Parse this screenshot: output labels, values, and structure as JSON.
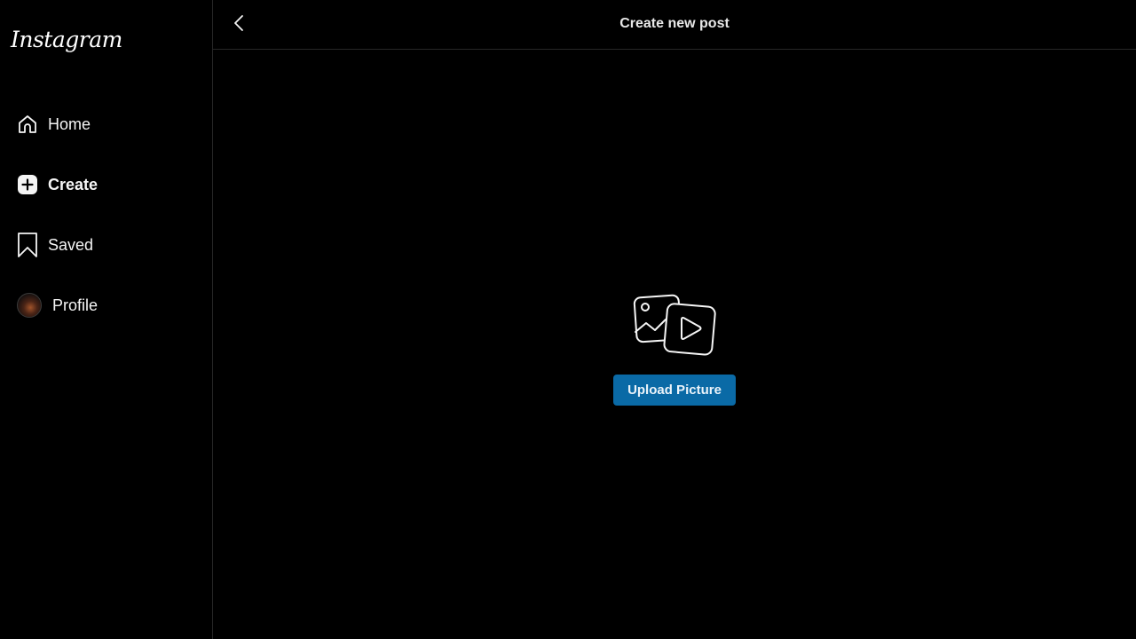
{
  "app": {
    "logo_text": "Instagram"
  },
  "sidebar": {
    "items": [
      {
        "label": "Home",
        "icon": "home-icon",
        "active": false
      },
      {
        "label": "Create",
        "icon": "plus-square-icon",
        "active": true
      },
      {
        "label": "Saved",
        "icon": "bookmark-icon",
        "active": false
      },
      {
        "label": "Profile",
        "icon": "avatar",
        "active": false
      }
    ]
  },
  "header": {
    "title": "Create new post",
    "back_icon": "chevron-left-icon"
  },
  "upload": {
    "icon": "photo-video-icon",
    "button_label": "Upload Picture"
  },
  "colors": {
    "background": "#000000",
    "divider": "#262626",
    "accent": "#0a6aa6",
    "text": "#f5f5f5"
  }
}
